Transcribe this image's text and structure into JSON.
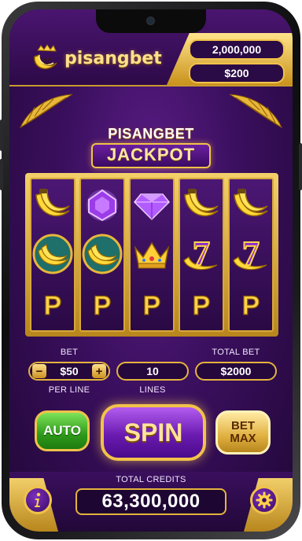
{
  "brand": {
    "name": "pisangbet"
  },
  "balances": {
    "top": "2,000,000",
    "bottom": "$200"
  },
  "jackpot": {
    "line1": "PISANGBET",
    "line2": "JACKPOT"
  },
  "reels": [
    [
      "banana",
      "banana-coin",
      "p-coin"
    ],
    [
      "gem",
      "banana-coin",
      "p-coin"
    ],
    [
      "diamond",
      "crown",
      "p-coin"
    ],
    [
      "banana",
      "seven",
      "p-coin"
    ],
    [
      "banana",
      "seven",
      "p-coin"
    ]
  ],
  "controls": {
    "bet_label": "BET",
    "bet_value": "$50",
    "bet_minus": "−",
    "bet_plus": "+",
    "per_line_label": "PER LINE",
    "lines_value": "10",
    "lines_label": "LINES",
    "total_bet_label": "TOTAL BET",
    "total_bet_value": "$2000"
  },
  "buttons": {
    "auto": "AUTO",
    "spin": "SPIN",
    "bet_max_line1": "BET",
    "bet_max_line2": "MAX"
  },
  "footer": {
    "credits_label": "TOTAL CREDITS",
    "credits_value": "63,300,000",
    "info_icon": "info-icon",
    "settings_icon": "gear-icon"
  },
  "colors": {
    "gold": "#f2c24a",
    "purple": "#4a0a8a",
    "green": "#2e9a1a"
  },
  "symbol_p": "P",
  "symbol_seven": "7"
}
